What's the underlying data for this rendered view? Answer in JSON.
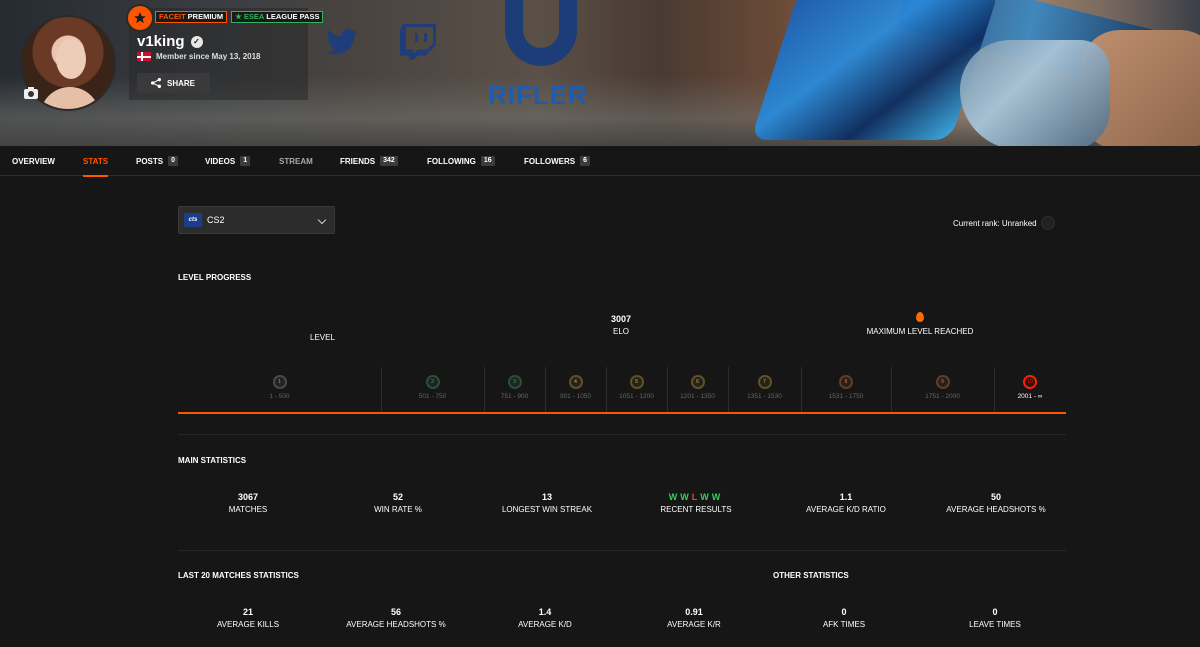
{
  "profile": {
    "username": "v1king",
    "member_since": "Member since May 13, 2018",
    "share_label": "SHARE",
    "badges": {
      "premium_brand": "FACEIT",
      "premium_label": "PREMIUM",
      "esea_brand": "ESEA",
      "esea_label": "LEAGUE PASS"
    },
    "banner_text": "RIFLER"
  },
  "nav": [
    {
      "label": "OVERVIEW"
    },
    {
      "label": "STATS",
      "active": true
    },
    {
      "label": "POSTS",
      "count": "0"
    },
    {
      "label": "VIDEOS",
      "count": "1"
    },
    {
      "label": "STREAM"
    },
    {
      "label": "FRIENDS",
      "count": "342"
    },
    {
      "label": "FOLLOWING",
      "count": "16"
    },
    {
      "label": "FOLLOWERS",
      "count": "6"
    }
  ],
  "game": {
    "logo": "cts",
    "name": "CS2"
  },
  "rank": {
    "text": "Current rank: Unranked"
  },
  "level_progress": {
    "title": "LEVEL PROGRESS",
    "level_label": "LEVEL",
    "elo": "3007",
    "elo_label": "ELO",
    "max_label": "MAXIMUM LEVEL REACHED",
    "levels": [
      {
        "n": "1",
        "range": "1 - 500",
        "color": "#9a9a9a"
      },
      {
        "n": "2",
        "range": "501 - 750",
        "color": "#2fb35b"
      },
      {
        "n": "3",
        "range": "751 - 900",
        "color": "#2fb35b"
      },
      {
        "n": "4",
        "range": "901 - 1050",
        "color": "#e4b21c"
      },
      {
        "n": "5",
        "range": "1051 - 1200",
        "color": "#e4b21c"
      },
      {
        "n": "6",
        "range": "1201 - 1350",
        "color": "#e4b21c"
      },
      {
        "n": "7",
        "range": "1351 - 1530",
        "color": "#e4b21c"
      },
      {
        "n": "8",
        "range": "1531 - 1750",
        "color": "#ff6a1a"
      },
      {
        "n": "9",
        "range": "1751 - 2000",
        "color": "#ff6a1a"
      },
      {
        "n": "10",
        "range": "2001 - ∞",
        "color": "#fe1f00"
      }
    ]
  },
  "main_stats": {
    "title": "MAIN STATISTICS",
    "items": [
      {
        "value": "3067",
        "label": "MATCHES"
      },
      {
        "value": "52",
        "label": "WIN RATE %"
      },
      {
        "value": "13",
        "label": "LONGEST WIN STREAK"
      },
      {
        "value": "",
        "label": "RECENT RESULTS"
      },
      {
        "value": "1.1",
        "label": "AVERAGE K/D RATIO"
      },
      {
        "value": "50",
        "label": "AVERAGE HEADSHOTS %"
      }
    ],
    "recent_results": [
      "W",
      "W",
      "L",
      "W",
      "W"
    ]
  },
  "last20": {
    "title": "LAST 20 MATCHES STATISTICS",
    "items": [
      {
        "value": "21",
        "label": "AVERAGE KILLS"
      },
      {
        "value": "56",
        "label": "AVERAGE HEADSHOTS %"
      },
      {
        "value": "1.4",
        "label": "AVERAGE K/D"
      },
      {
        "value": "0.91",
        "label": "AVERAGE K/R"
      }
    ]
  },
  "other": {
    "title": "OTHER STATISTICS",
    "items": [
      {
        "value": "0",
        "label": "AFK TIMES"
      },
      {
        "value": "0",
        "label": "LEAVE TIMES"
      }
    ]
  }
}
